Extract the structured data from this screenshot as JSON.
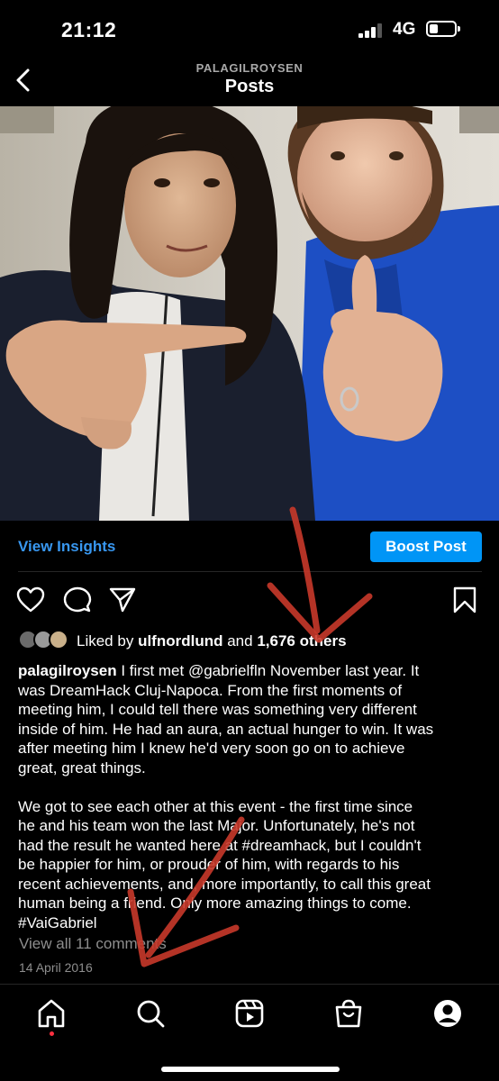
{
  "status": {
    "time": "21:12",
    "network": "4G",
    "battery_level": 0.25
  },
  "header": {
    "username": "PALAGILROYSEN",
    "title": "Posts"
  },
  "insights": {
    "view_label": "View Insights",
    "boost_label": "Boost Post"
  },
  "likes": {
    "prefix": "Liked by",
    "user": "ulfnordlund",
    "conj": "and",
    "count": "1,676 others"
  },
  "caption": {
    "username": "palagilroysen",
    "lines_p1": [
      "I first met @gabrielfln November last year. It",
      "was DreamHack Cluj-Napoca. From the first moments of",
      "meeting him, I could tell there was something very different",
      "inside of him. He had an aura, an actual hunger to win. It was",
      "after meeting him I knew he'd very soon go on to achieve",
      "great, great things."
    ],
    "lines_p2": [
      "We got to see each other at this event - the first time since",
      "he and his team won the last Major. Unfortunately, he's not",
      "had the result he wanted here at #dreamhack, but I couldn't",
      "be happier for him, or prouder of him, with regards to his",
      "recent achievements, and, more importantly, to call this great",
      "human being a friend. Only more amazing things to come.",
      "#VaiGabriel"
    ]
  },
  "comments": {
    "view_all_label": "View all 11 comments"
  },
  "post_date": "14 April 2016",
  "colors": {
    "accent": "#0095f6",
    "link": "#3897f0",
    "annotation_arrow": "#c8382a",
    "muted": "#8e8e8e"
  },
  "icons": {
    "back": "chevron-left-icon",
    "like": "heart-icon",
    "comment": "comment-bubble-icon",
    "share": "paper-plane-icon",
    "save": "bookmark-icon",
    "tabs": [
      "home-icon",
      "search-icon",
      "reels-icon",
      "shop-icon",
      "profile-icon"
    ]
  }
}
